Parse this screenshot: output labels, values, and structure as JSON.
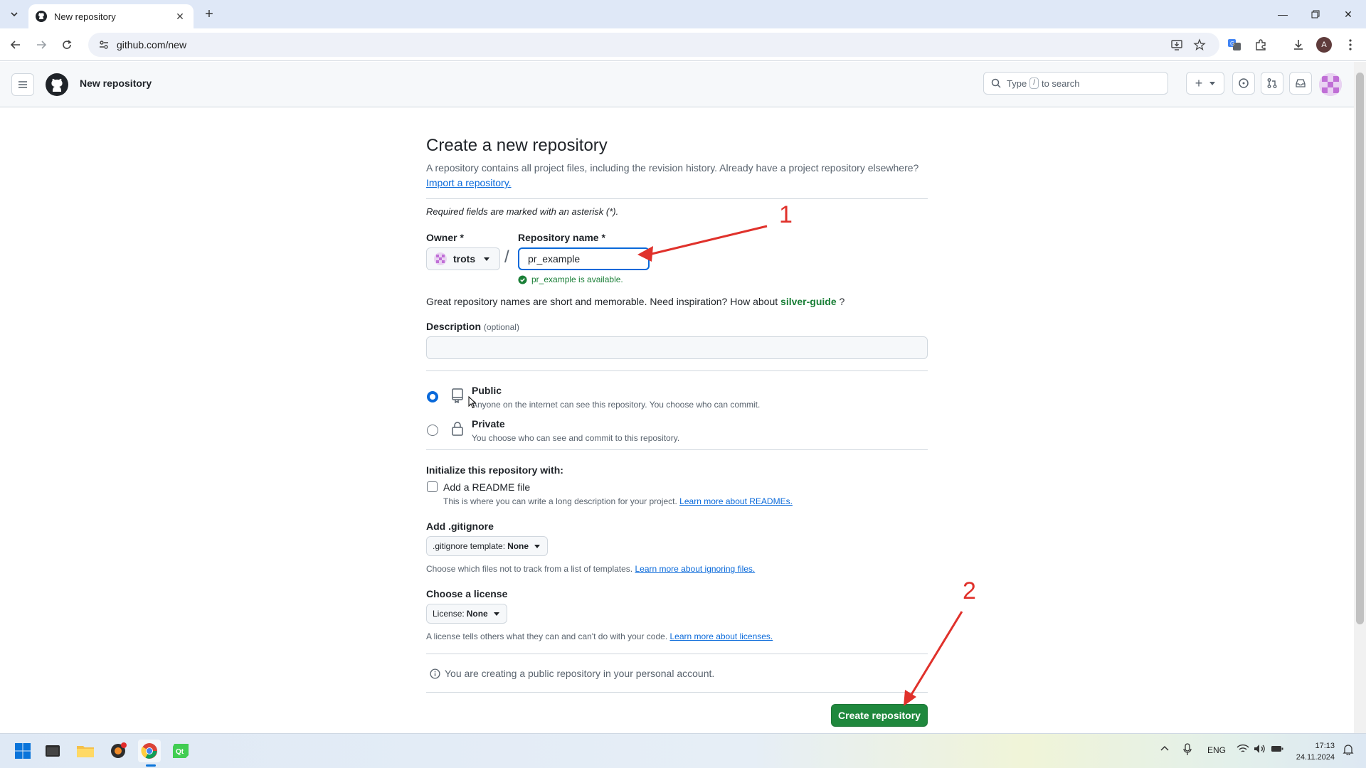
{
  "browser": {
    "tab_title": "New repository",
    "url": "github.com/new",
    "profile_initial": "A"
  },
  "header": {
    "context": "New repository",
    "search_prefix": "Type",
    "search_key": "/",
    "search_suffix": "to search"
  },
  "form": {
    "title": "Create a new repository",
    "subtitle": "A repository contains all project files, including the revision history. Already have a project repository elsewhere?",
    "import_link": "Import a repository.",
    "required_note": "Required fields are marked with an asterisk (*).",
    "owner_label": "Owner *",
    "owner_value": "trots",
    "slash": "/",
    "repo_name_label": "Repository name *",
    "repo_name_value": "pr_example",
    "availability": "pr_example is available.",
    "inspiration_text": "Great repository names are short and memorable. Need inspiration? How about",
    "inspiration_suggestion": "silver-guide",
    "inspiration_end": "?",
    "description_label": "Description",
    "description_optional": "(optional)",
    "visibility": {
      "public_title": "Public",
      "public_desc": "Anyone on the internet can see this repository. You choose who can commit.",
      "private_title": "Private",
      "private_desc": "You choose who can see and commit to this repository."
    },
    "init_heading": "Initialize this repository with:",
    "readme_label": "Add a README file",
    "readme_desc": "This is where you can write a long description for your project.",
    "readme_link": "Learn more about READMEs.",
    "gitignore_heading": "Add .gitignore",
    "gitignore_select_prefix": ".gitignore template:",
    "gitignore_select_value": "None",
    "gitignore_desc": "Choose which files not to track from a list of templates.",
    "gitignore_link": "Learn more about ignoring files.",
    "license_heading": "Choose a license",
    "license_select_prefix": "License:",
    "license_select_value": "None",
    "license_desc": "A license tells others what they can and can't do with your code.",
    "license_link": "Learn more about licenses.",
    "info_text": "You are creating a public repository in your personal account.",
    "create_button": "Create repository"
  },
  "annotations": {
    "label_1": "1",
    "label_2": "2",
    "color": "#e0312b"
  },
  "taskbar": {
    "language": "ENG",
    "time": "17:13",
    "date": "24.11.2024"
  },
  "colors": {
    "accent_blue": "#0969da",
    "success_green": "#1f883d",
    "available_green": "#1a7f37"
  }
}
